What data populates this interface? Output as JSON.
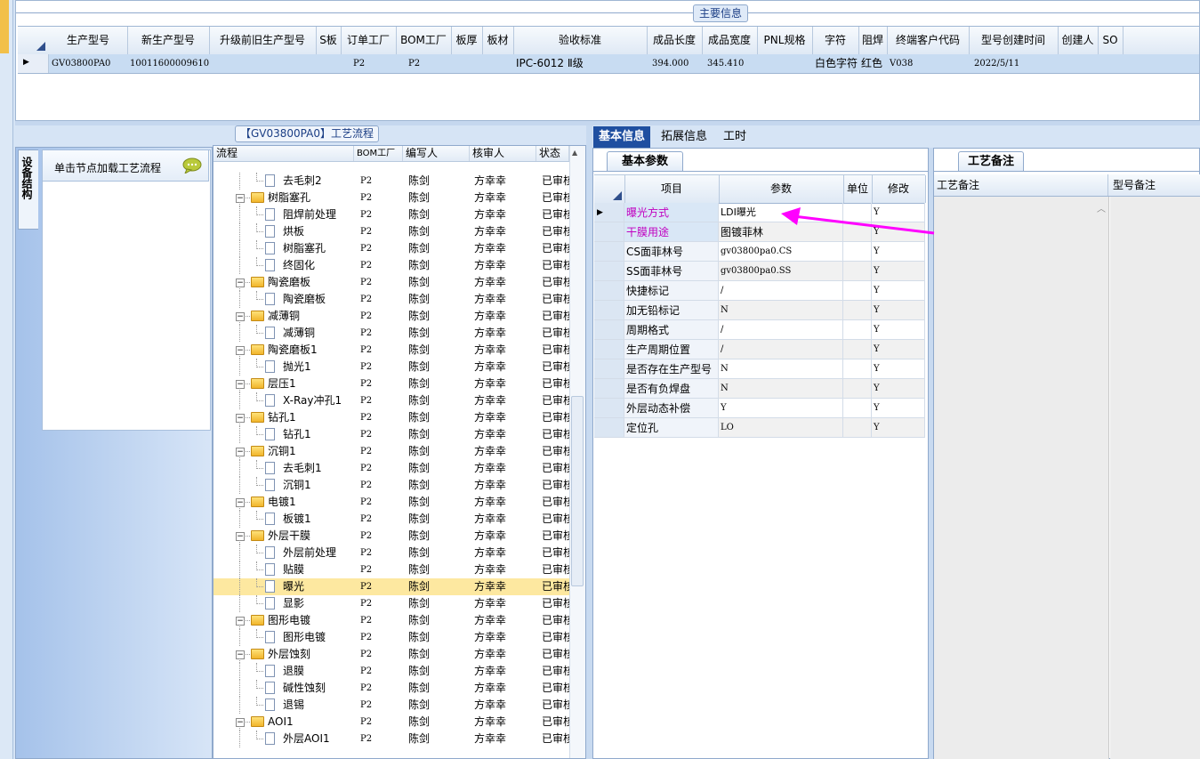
{
  "main_info": {
    "title": "主要信息",
    "columns": [
      "生产型号",
      "新生产型号",
      "升级前旧生产型号",
      "S板",
      "订单工厂",
      "BOM工厂",
      "板厚",
      "板材",
      "验收标准",
      "成品长度",
      "成品宽度",
      "PNL规格",
      "字符",
      "阻焊",
      "终端客户代码",
      "型号创建时间",
      "创建人",
      "SO"
    ],
    "row": {
      "model": "GV03800PA0",
      "new_model": "10011600009610",
      "old_model": "",
      "s_board": "",
      "order_factory": "P2",
      "bom_factory": "P2",
      "thickness": "",
      "material": "",
      "standard": "IPC-6012 Ⅱ级",
      "length": "394.000",
      "width": "345.410",
      "pnl": "",
      "char": "白色字符",
      "solder": "红色",
      "customer": "V038",
      "created": "2022/5/11",
      "creator": "",
      "so": ""
    }
  },
  "side_panel": {
    "tab_label": "设备结构",
    "node_hint": "单击节点加载工艺流程"
  },
  "process_tree": {
    "title": "【GV03800PA0】工艺流程",
    "columns": [
      "流程",
      "BOM工厂",
      "编写人",
      "核审人",
      "状态"
    ],
    "rows": [
      {
        "level": 2,
        "name": "去毛刺2",
        "bom": "P2",
        "writer": "陈剑",
        "reviewer": "方幸幸",
        "status": "已审核"
      },
      {
        "level": 1,
        "name": "树脂塞孔",
        "bom": "P2",
        "writer": "陈剑",
        "reviewer": "方幸幸",
        "status": "已审核"
      },
      {
        "level": 2,
        "name": "阻焊前处理",
        "bom": "P2",
        "writer": "陈剑",
        "reviewer": "方幸幸",
        "status": "已审核"
      },
      {
        "level": 2,
        "name": "烘板",
        "bom": "P2",
        "writer": "陈剑",
        "reviewer": "方幸幸",
        "status": "已审核"
      },
      {
        "level": 2,
        "name": "树脂塞孔",
        "bom": "P2",
        "writer": "陈剑",
        "reviewer": "方幸幸",
        "status": "已审核"
      },
      {
        "level": 2,
        "name": "终固化",
        "bom": "P2",
        "writer": "陈剑",
        "reviewer": "方幸幸",
        "status": "已审核"
      },
      {
        "level": 1,
        "name": "陶瓷磨板",
        "bom": "P2",
        "writer": "陈剑",
        "reviewer": "方幸幸",
        "status": "已审核"
      },
      {
        "level": 2,
        "name": "陶瓷磨板",
        "bom": "P2",
        "writer": "陈剑",
        "reviewer": "方幸幸",
        "status": "已审核"
      },
      {
        "level": 1,
        "name": "减薄铜",
        "bom": "P2",
        "writer": "陈剑",
        "reviewer": "方幸幸",
        "status": "已审核"
      },
      {
        "level": 2,
        "name": "减薄铜",
        "bom": "P2",
        "writer": "陈剑",
        "reviewer": "方幸幸",
        "status": "已审核"
      },
      {
        "level": 1,
        "name": "陶瓷磨板1",
        "bom": "P2",
        "writer": "陈剑",
        "reviewer": "方幸幸",
        "status": "已审核"
      },
      {
        "level": 2,
        "name": "抛光1",
        "bom": "P2",
        "writer": "陈剑",
        "reviewer": "方幸幸",
        "status": "已审核"
      },
      {
        "level": 1,
        "name": "层压1",
        "bom": "P2",
        "writer": "陈剑",
        "reviewer": "方幸幸",
        "status": "已审核"
      },
      {
        "level": 2,
        "name": "X-Ray冲孔1",
        "bom": "P2",
        "writer": "陈剑",
        "reviewer": "方幸幸",
        "status": "已审核"
      },
      {
        "level": 1,
        "name": "钻孔1",
        "bom": "P2",
        "writer": "陈剑",
        "reviewer": "方幸幸",
        "status": "已审核"
      },
      {
        "level": 2,
        "name": "钻孔1",
        "bom": "P2",
        "writer": "陈剑",
        "reviewer": "方幸幸",
        "status": "已审核"
      },
      {
        "level": 1,
        "name": "沉铜1",
        "bom": "P2",
        "writer": "陈剑",
        "reviewer": "方幸幸",
        "status": "已审核"
      },
      {
        "level": 2,
        "name": "去毛刺1",
        "bom": "P2",
        "writer": "陈剑",
        "reviewer": "方幸幸",
        "status": "已审核"
      },
      {
        "level": 2,
        "name": "沉铜1",
        "bom": "P2",
        "writer": "陈剑",
        "reviewer": "方幸幸",
        "status": "已审核"
      },
      {
        "level": 1,
        "name": "电镀1",
        "bom": "P2",
        "writer": "陈剑",
        "reviewer": "方幸幸",
        "status": "已审核"
      },
      {
        "level": 2,
        "name": "板镀1",
        "bom": "P2",
        "writer": "陈剑",
        "reviewer": "方幸幸",
        "status": "已审核"
      },
      {
        "level": 1,
        "name": "外层干膜",
        "bom": "P2",
        "writer": "陈剑",
        "reviewer": "方幸幸",
        "status": "已审核"
      },
      {
        "level": 2,
        "name": "外层前处理",
        "bom": "P2",
        "writer": "陈剑",
        "reviewer": "方幸幸",
        "status": "已审核"
      },
      {
        "level": 2,
        "name": "贴膜",
        "bom": "P2",
        "writer": "陈剑",
        "reviewer": "方幸幸",
        "status": "已审核"
      },
      {
        "level": 2,
        "name": "曝光",
        "bom": "P2",
        "writer": "陈剑",
        "reviewer": "方幸幸",
        "status": "已审核",
        "selected": true
      },
      {
        "level": 2,
        "name": "显影",
        "bom": "P2",
        "writer": "陈剑",
        "reviewer": "方幸幸",
        "status": "已审核"
      },
      {
        "level": 1,
        "name": "图形电镀",
        "bom": "P2",
        "writer": "陈剑",
        "reviewer": "方幸幸",
        "status": "已审核"
      },
      {
        "level": 2,
        "name": "图形电镀",
        "bom": "P2",
        "writer": "陈剑",
        "reviewer": "方幸幸",
        "status": "已审核"
      },
      {
        "level": 1,
        "name": "外层蚀刻",
        "bom": "P2",
        "writer": "陈剑",
        "reviewer": "方幸幸",
        "status": "已审核"
      },
      {
        "level": 2,
        "name": "退膜",
        "bom": "P2",
        "writer": "陈剑",
        "reviewer": "方幸幸",
        "status": "已审核"
      },
      {
        "level": 2,
        "name": "碱性蚀刻",
        "bom": "P2",
        "writer": "陈剑",
        "reviewer": "方幸幸",
        "status": "已审核"
      },
      {
        "level": 2,
        "name": "退锡",
        "bom": "P2",
        "writer": "陈剑",
        "reviewer": "方幸幸",
        "status": "已审核"
      },
      {
        "level": 1,
        "name": "AOI1",
        "bom": "P2",
        "writer": "陈剑",
        "reviewer": "方幸幸",
        "status": "已审核"
      },
      {
        "level": 2,
        "name": "外层AOI1",
        "bom": "P2",
        "writer": "陈剑",
        "reviewer": "方幸幸",
        "status": "已审核"
      }
    ]
  },
  "info_tabs": [
    "基本信息",
    "拓展信息",
    "工时"
  ],
  "basic_params": {
    "subtab": "基本参数",
    "columns": [
      "项目",
      "参数",
      "单位",
      "修改"
    ],
    "rows": [
      {
        "item": "曝光方式",
        "value": "LDI曝光",
        "unit": "",
        "edit": "Y",
        "highlight": true
      },
      {
        "item": "干膜用途",
        "value": "图镀菲林",
        "unit": "",
        "edit": "Y",
        "highlight": true
      },
      {
        "item": "CS面菲林号",
        "value": "gv03800pa0.CS",
        "unit": "",
        "edit": "Y"
      },
      {
        "item": "SS面菲林号",
        "value": "gv03800pa0.SS",
        "unit": "",
        "edit": "Y"
      },
      {
        "item": "快捷标记",
        "value": "/",
        "unit": "",
        "edit": "Y"
      },
      {
        "item": "加无铅标记",
        "value": "N",
        "unit": "",
        "edit": "Y"
      },
      {
        "item": "周期格式",
        "value": "/",
        "unit": "",
        "edit": "Y"
      },
      {
        "item": "生产周期位置",
        "value": "/",
        "unit": "",
        "edit": "Y"
      },
      {
        "item": "是否存在生产型号",
        "value": "N",
        "unit": "",
        "edit": "Y"
      },
      {
        "item": "是否有负焊盘",
        "value": "N",
        "unit": "",
        "edit": "Y"
      },
      {
        "item": "外层动态补偿",
        "value": "Y",
        "unit": "",
        "edit": "Y"
      },
      {
        "item": "定位孔",
        "value": "LO",
        "unit": "",
        "edit": "Y"
      }
    ]
  },
  "process_notes": {
    "subtab": "工艺备注",
    "columns": [
      "工艺备注",
      "型号备注"
    ]
  },
  "colors": {
    "accent": "#1f4fa0",
    "highlight_text": "#c000c0",
    "annotation_arrow": "#ff00ff",
    "selected_row": "#fde8a0"
  }
}
